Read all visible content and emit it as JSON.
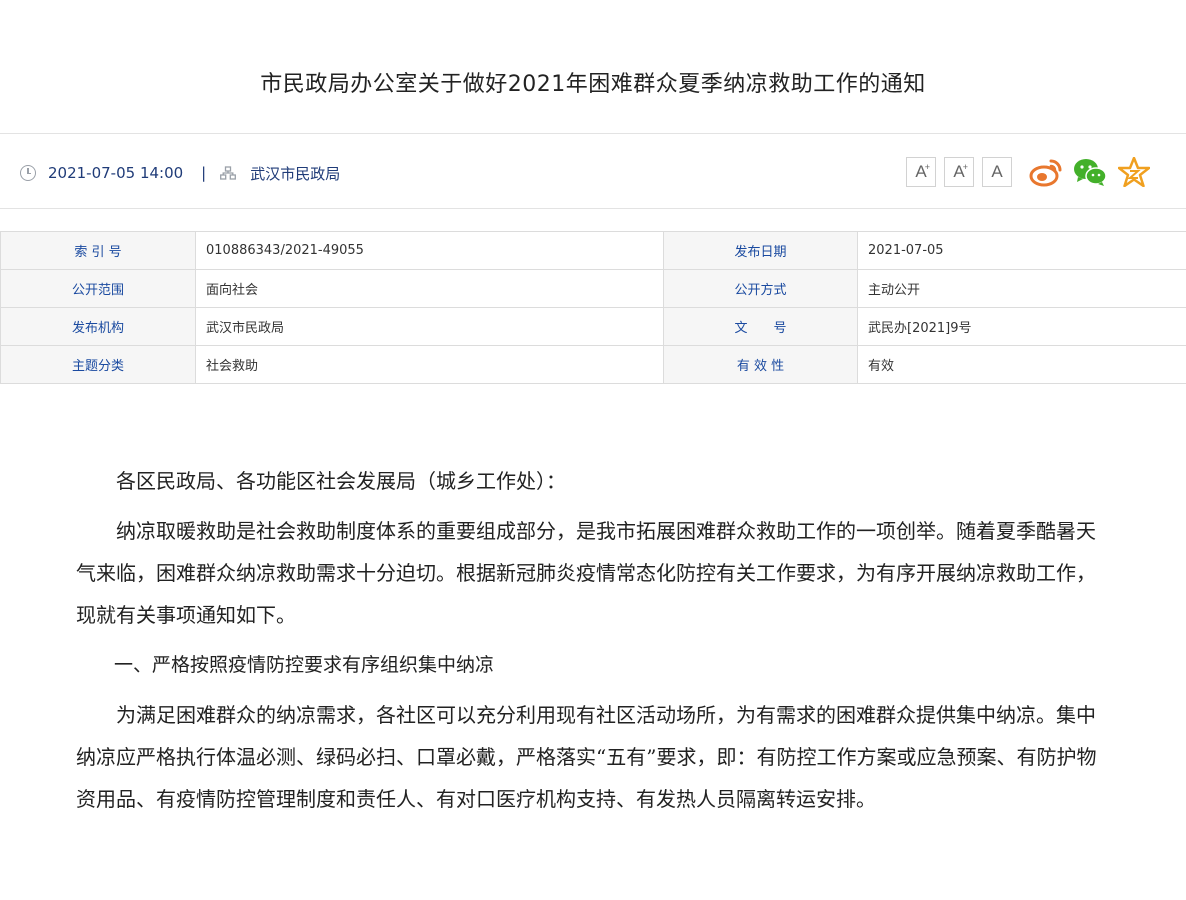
{
  "title": "市民政局办公室关于做好2021年困难群众夏季纳凉救助工作的通知",
  "meta": {
    "datetime": "2021-07-05 14:00",
    "separator": "|",
    "publisher": "武汉市民政局"
  },
  "tools": {
    "font_large": "A",
    "font_medium": "A",
    "font_small": "A",
    "icons": [
      "weibo-icon",
      "wechat-icon",
      "favorite-star-icon"
    ]
  },
  "info": {
    "index_label": "索 引 号",
    "index_value": "010886343/2021-49055",
    "date_label": "发布日期",
    "date_value": "2021-07-05",
    "scope_label": "公开范围",
    "scope_value": "面向社会",
    "method_label": "公开方式",
    "method_value": "主动公开",
    "org_label": "发布机构",
    "org_value": "武汉市民政局",
    "docno_label": "文　　号",
    "docno_value": "武民办[2021]9号",
    "topic_label": "主题分类",
    "topic_value": "社会救助",
    "validity_label": "有 效 性",
    "validity_value": "有效"
  },
  "content": {
    "salutation": "各区民政局、各功能区社会发展局（城乡工作处）：",
    "para1": "纳凉取暖救助是社会救助制度体系的重要组成部分，是我市拓展困难群众救助工作的一项创举。随着夏季酷暑天气来临，困难群众纳凉救助需求十分迫切。根据新冠肺炎疫情常态化防控有关工作要求，为有序开展纳凉救助工作，现就有关事项通知如下。",
    "heading1": "一、严格按照疫情防控要求有序组织集中纳凉",
    "para2": "为满足困难群众的纳凉需求，各社区可以充分利用现有社区活动场所，为有需求的困难群众提供集中纳凉。集中纳凉应严格执行体温必测、绿码必扫、口罩必戴，严格落实“五有”要求，即：有防控工作方案或应急预案、有防护物资用品、有疫情防控管理制度和责任人、有对口医疗机构支持、有发热人员隔离转运安排。"
  },
  "colors": {
    "label_blue": "#1a4aa0",
    "meta_blue": "#1f3b78",
    "weibo_orange": "#e8772e",
    "wechat_green": "#43b02a",
    "star_orange": "#f0a020"
  }
}
